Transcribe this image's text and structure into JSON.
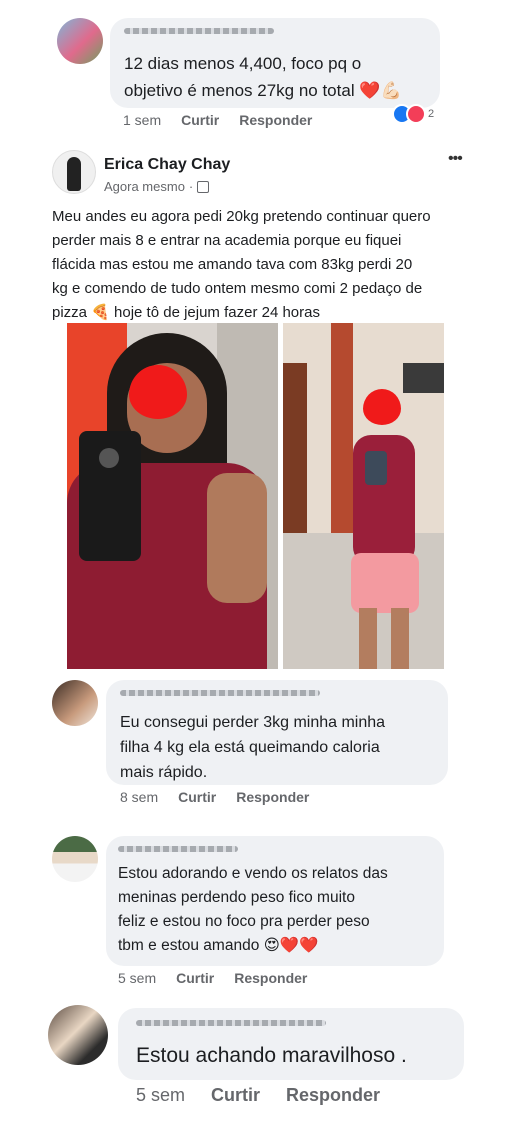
{
  "comments": [
    {
      "text": "12 dias menos 4,400, foco pq o\nobjetivo é menos 27kg no total ❤️💪🏻",
      "time": "1 sem",
      "like": "Curtir",
      "reply": "Responder",
      "reaction_count": "2"
    },
    {
      "text": "Eu consegui perder 3kg minha minha\nfilha 4 kg ela está queimando caloria\nmais rápido.",
      "time": "8 sem",
      "like": "Curtir",
      "reply": "Responder"
    },
    {
      "text": "Estou adorando e vendo os relatos das\nmeninas perdendo peso fico muito\nfeliz e estou no foco pra perder peso\ntbm e estou amando 😍❤️❤️",
      "time": "5 sem",
      "like": "Curtir",
      "reply": "Responder"
    },
    {
      "text": "Estou achando maravilhoso .",
      "time": "5 sem",
      "like": "Curtir",
      "reply": "Responder"
    }
  ],
  "post": {
    "author": "Erica Chay Chay",
    "time": "Agora mesmo",
    "privacy_icon": "friends-icon",
    "more_icon": "•••",
    "text": "Meu andes eu agora pedi 20kg pretendo continuar quero\nperder mais 8 e entrar na academia porque eu fiquei\nflácida mas estou me amando tava com 83kg perdi 20\nkg e comendo de tudo ontem mesmo comi 2 pedaço de\npizza 🍕 hoje tô de jejum fazer 24 horas"
  },
  "colors": {
    "bubble": "#eff1f4",
    "meta": "#65676b",
    "like_blue": "#1877f2",
    "love_red": "#f33e58"
  }
}
